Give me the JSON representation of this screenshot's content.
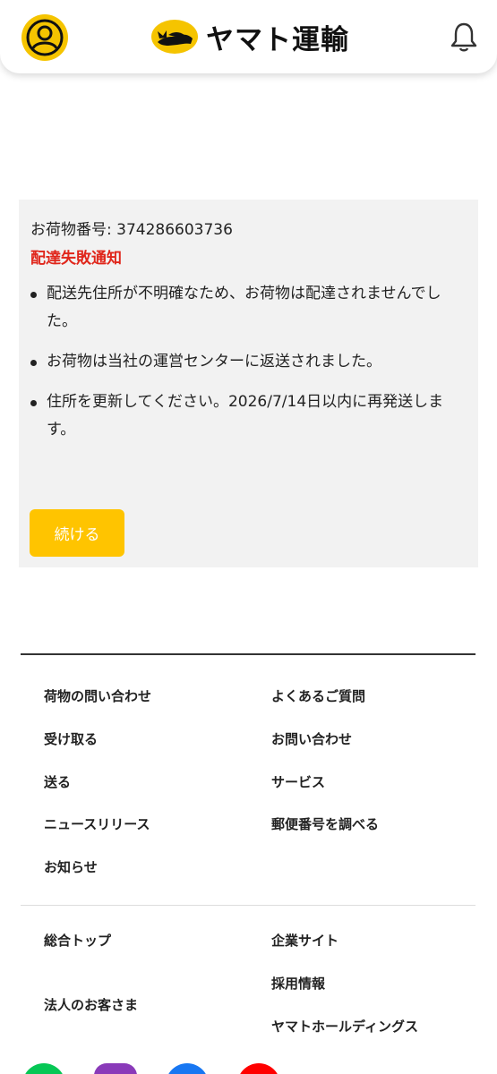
{
  "header": {
    "brand": "ヤマト運輸",
    "icons": {
      "profile": "user-avatar-icon",
      "logo": "black-cat-logo",
      "notifications": "bell-icon"
    },
    "colors": {
      "brand_yellow": "#f5c400"
    }
  },
  "notice": {
    "tracking_number": "お荷物番号: 374286603736",
    "title": "配達失敗通知",
    "items": [
      "配送先住所が不明確なため、お荷物は配達されませんでした。",
      "お荷物は当社の運営センターに返送されました。",
      "住所を更新してください。2026/7/14日以内に再発送します。"
    ],
    "continue_label": "続ける",
    "colors": {
      "alert": "#e0261b",
      "button": "#ffc400",
      "card_bg": "#f2f2f2"
    }
  },
  "footer": {
    "links_primary_left": [
      "荷物の問い合わせ",
      "受け取る",
      "送る",
      "ニュースリリース",
      "お知らせ"
    ],
    "links_primary_right": [
      "よくあるご質問",
      "お問い合わせ",
      "サービス",
      "郵便番号を調べる"
    ],
    "links_secondary_left": [
      "総合トップ",
      "法人のお客さま"
    ],
    "links_secondary_right": [
      "企業サイト",
      "採用情報",
      "ヤマトホールディングス"
    ],
    "social_icons": [
      {
        "name": "line-icon",
        "color": "#06c755"
      },
      {
        "name": "instagram-icon",
        "color": "#8a3ab9"
      },
      {
        "name": "facebook-icon",
        "color": "#1877f2"
      },
      {
        "name": "youtube-icon",
        "color": "#ff0000"
      }
    ]
  }
}
